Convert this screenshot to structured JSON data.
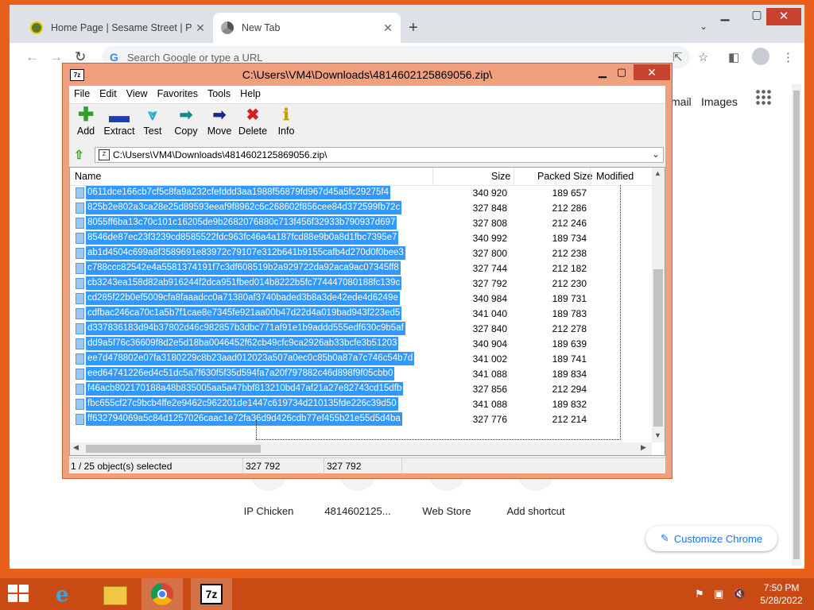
{
  "chrome": {
    "tabs": [
      {
        "title": "Home Page | Sesame Street | PBS"
      },
      {
        "title": "New Tab"
      }
    ],
    "new_tab": "+",
    "omnibox_placeholder": "Search Google or type a URL",
    "ntp_links": [
      "mail",
      "Images"
    ],
    "shortcuts": [
      "IP Chicken",
      "4814602125...",
      "Web Store",
      "Add shortcut"
    ],
    "customize_label": "Customize Chrome"
  },
  "zip": {
    "title": "C:\\Users\\VM4\\Downloads\\4814602125869056.zip\\",
    "menu": [
      "File",
      "Edit",
      "View",
      "Favorites",
      "Tools",
      "Help"
    ],
    "tools": [
      {
        "label": "Add",
        "icon": "add-icon",
        "color": "#2e9e2e"
      },
      {
        "label": "Extract",
        "icon": "extract-icon",
        "color": "#1f3fa8"
      },
      {
        "label": "Test",
        "icon": "test-icon",
        "color": "#2aa8c8"
      },
      {
        "label": "Copy",
        "icon": "copy-icon",
        "color": "#1a8a8a"
      },
      {
        "label": "Move",
        "icon": "move-icon",
        "color": "#1a2a8a"
      },
      {
        "label": "Delete",
        "icon": "delete-icon",
        "color": "#d42020"
      },
      {
        "label": "Info",
        "icon": "info-icon",
        "color": "#c8a000"
      }
    ],
    "address": "C:\\Users\\VM4\\Downloads\\4814602125869056.zip\\",
    "columns": {
      "name": "Name",
      "size": "Size",
      "packed": "Packed Size",
      "modified": "Modified"
    },
    "files": [
      {
        "name": "0611dce166cb7cf5c8fa9a232cfefddd3aa1988f56879fd967d45a5fc29275f4",
        "size": "340 920",
        "packed": "189 657"
      },
      {
        "name": "825b2e802a3ca28e25d89593eeaf9f8962c6c268602f856cee84d372599fb72c",
        "size": "327 848",
        "packed": "212 286"
      },
      {
        "name": "8055ff6ba13c70c101c16205de9b2682076880c713f456f32933b790937d697",
        "size": "327 808",
        "packed": "212 246"
      },
      {
        "name": "8546de87ec23f3239cd8585522fdc963fc46a4a187fcd88e9b0a8d1fbc7395e7",
        "size": "340 992",
        "packed": "189 734"
      },
      {
        "name": "ab1d4504c699a8f3589691e83972c79107e312b641b9155cafb4d270d0f0bee3",
        "size": "327 800",
        "packed": "212 238"
      },
      {
        "name": "c788ccc82542e4a5581374191f7c3df608519b2a929722da92aca9ac07345ff8",
        "size": "327 744",
        "packed": "212 182"
      },
      {
        "name": "cb3243ea158d82ab916244f2dca951fbed014b8222b5fc774447080188fc139c",
        "size": "327 792",
        "packed": "212 230"
      },
      {
        "name": "cd285f22b0ef5009cfa8faaadcc0a71380af3740baded3b8a3de42ede4d6249e",
        "size": "340 984",
        "packed": "189 731"
      },
      {
        "name": "cdfbac246ca70c1a5b7f1cae8e7345fe921aa00b47d22d4a019bad943f223ed5",
        "size": "341 040",
        "packed": "189 783"
      },
      {
        "name": "d337836183d94b37802d46c982857b3dbc771af91e1b9addd555edf630c9b5af",
        "size": "327 840",
        "packed": "212 278"
      },
      {
        "name": "dd9a5f76c36609f8d2e5d18ba0046452f62cb49cfc9ca2926ab33bcfe3b51203",
        "size": "340 904",
        "packed": "189 639"
      },
      {
        "name": "ee7d478802e07fa3180229c8b23aad012023a507a0ec0c85b0a87a7c746c54b7d",
        "size": "341 002",
        "packed": "189 741"
      },
      {
        "name": "eed64741226ed4c51dc5a7f630f5f35d594fa7a20f797882c46d898f9f05cbb0",
        "size": "341 088",
        "packed": "189 834"
      },
      {
        "name": "f46acb802170188a48b835005aa5a47bbf813210bd47af21a27e82743cd15dfb",
        "size": "327 856",
        "packed": "212 294"
      },
      {
        "name": "fbc655cf27c9bcb4ffe2e9462c962201de1447c619734d210135fde226c39d50",
        "size": "341 088",
        "packed": "189 832"
      },
      {
        "name": "ff632794069a5c84d1257026caac1e72fa36d9d426cdb77ef455b21e55d5d4ba",
        "size": "327 776",
        "packed": "212 214"
      }
    ],
    "status": {
      "selection": "1 / 25 object(s) selected",
      "size": "327 792",
      "packed": "327 792"
    }
  },
  "taskbar": {
    "time": "7:50 PM",
    "date": "5/28/2022",
    "accent": "#c94a12"
  }
}
